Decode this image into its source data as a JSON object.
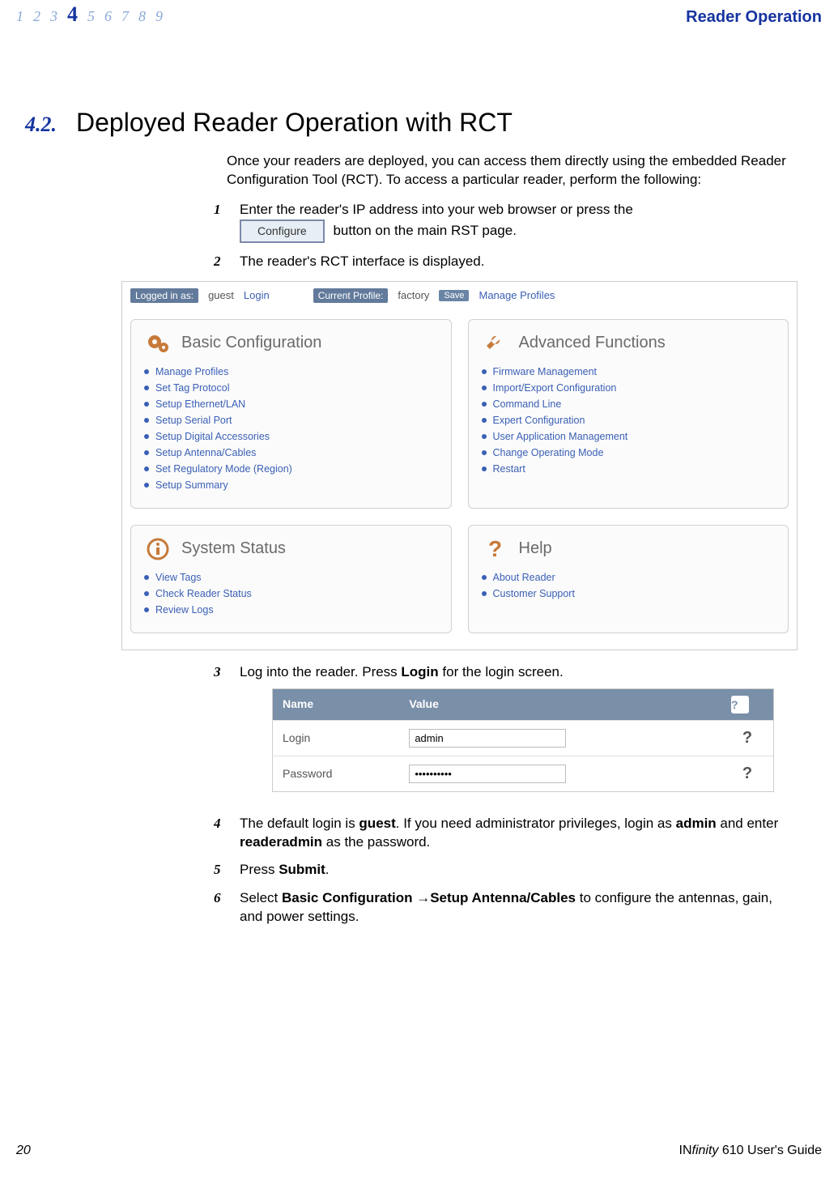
{
  "header": {
    "chapters": [
      "1",
      "2",
      "3",
      "4",
      "5",
      "6",
      "7",
      "8",
      "9"
    ],
    "active_index": 3,
    "right": "Reader Operation"
  },
  "section": {
    "num": "4.2.",
    "title": "Deployed Reader Operation with RCT"
  },
  "intro": "Once your readers are deployed, you can access them directly using the embedded Reader Configuration Tool (RCT). To access a particular reader, perform the following:",
  "steps": {
    "s1_a": "Enter the reader's IP address into your web browser or press the ",
    "s1_btn": "Configure",
    "s1_b": " button on the main RST page.",
    "s2": "The reader's RCT interface is displayed.",
    "s3_a": "Log into the reader. Press ",
    "s3_b": "Login",
    "s3_c": " for the login screen.",
    "s4_a": "The default login is ",
    "s4_b": "guest",
    "s4_c": ". If you need administrator privileges, login as ",
    "s4_d": "admin",
    "s4_e": " and enter ",
    "s4_f": "readeradmin",
    "s4_g": " as the password.",
    "s5_a": "Press ",
    "s5_b": "Submit",
    "s5_c": ".",
    "s6_a": "Select ",
    "s6_b": "Basic Configuration →Setup Antenna/Cables",
    "s6_c": " to configure the antennas, gain, and power settings."
  },
  "nums": {
    "n1": "1",
    "n2": "2",
    "n3": "3",
    "n4": "4",
    "n5": "5",
    "n6": "6"
  },
  "rct": {
    "logged_label": "Logged in as:",
    "guest": "guest",
    "login": "Login",
    "profile_label": "Current Profile:",
    "profile_val": "factory",
    "save": "Save",
    "manage": "Manage Profiles",
    "panels": {
      "basic": {
        "title": "Basic Configuration",
        "items": [
          "Manage Profiles",
          "Set Tag Protocol",
          "Setup Ethernet/LAN",
          "Setup Serial Port",
          "Setup Digital Accessories",
          "Setup Antenna/Cables",
          "Set Regulatory Mode (Region)",
          "Setup Summary"
        ]
      },
      "adv": {
        "title": "Advanced Functions",
        "items": [
          "Firmware Management",
          "Import/Export Configuration",
          "Command Line",
          "Expert Configuration",
          "User Application Management",
          "Change Operating Mode",
          "Restart"
        ]
      },
      "status": {
        "title": "System Status",
        "items": [
          "View Tags",
          "Check Reader Status",
          "Review Logs"
        ]
      },
      "help": {
        "title": "Help",
        "items": [
          "About Reader",
          "Customer Support"
        ]
      }
    }
  },
  "login_table": {
    "h_name": "Name",
    "h_value": "Value",
    "r1": "Login",
    "r1v": "admin",
    "r2": "Password",
    "r2v": "••••••••••",
    "q": "?"
  },
  "footer": {
    "page": "20",
    "guide_a": "IN",
    "guide_b": "finity",
    "guide_c": " 610 User's Guide"
  }
}
